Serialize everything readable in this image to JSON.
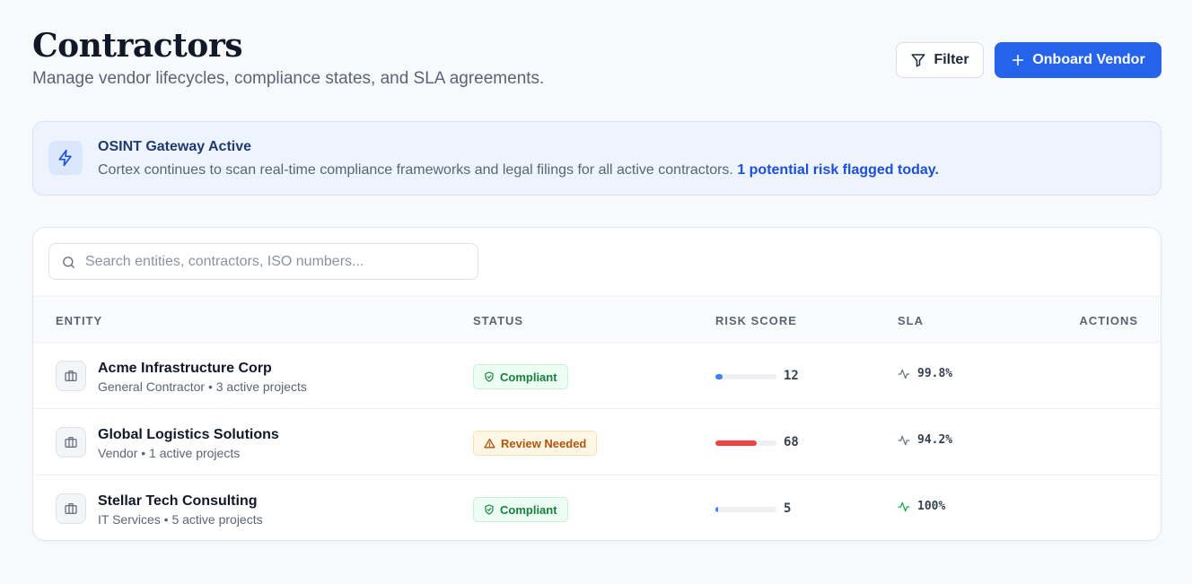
{
  "header": {
    "title": "Contractors",
    "subtitle": "Manage vendor lifecycles, compliance states, and SLA agreements.",
    "filter_label": "Filter",
    "onboard_label": "Onboard Vendor"
  },
  "banner": {
    "title": "OSINT Gateway Active",
    "text": "Cortex continues to scan real-time compliance frameworks and legal filings for all active contractors.",
    "highlight": "1 potential risk flagged today."
  },
  "search": {
    "placeholder": "Search entities, contractors, ISO numbers..."
  },
  "table": {
    "columns": {
      "entity": "ENTITY",
      "status": "STATUS",
      "risk": "RISK SCORE",
      "sla": "SLA",
      "actions": "ACTIONS"
    },
    "rows": [
      {
        "name": "Acme Infrastructure Corp",
        "meta": "General Contractor • 3 active projects",
        "status": "Compliant",
        "status_type": "ok",
        "risk_score": 12,
        "risk_label": "12",
        "sla": "99.8%",
        "sla_trend": "neutral"
      },
      {
        "name": "Global Logistics Solutions",
        "meta": "Vendor • 1 active projects",
        "status": "Review Needed",
        "status_type": "warn",
        "risk_score": 68,
        "risk_label": "68",
        "sla": "94.2%",
        "sla_trend": "neutral"
      },
      {
        "name": "Stellar Tech Consulting",
        "meta": "IT Services • 5 active projects",
        "status": "Compliant",
        "status_type": "ok",
        "risk_score": 5,
        "risk_label": "5",
        "sla": "100%",
        "sla_trend": "positive"
      }
    ]
  },
  "colors": {
    "accent": "#2563eb",
    "risk_low": "#3b82f6",
    "risk_high": "#ef4444",
    "compliant": "#17803d",
    "warning": "#b45309",
    "sla_positive": "#16a34a",
    "sla_neutral": "#6b7280"
  },
  "icons": {
    "filter": "funnel-icon",
    "onboard": "plus-icon",
    "banner": "lightning-icon",
    "search": "search-icon",
    "entity": "briefcase-icon",
    "compliant": "shield-check-icon",
    "review": "warning-triangle-icon",
    "sla": "activity-icon"
  }
}
